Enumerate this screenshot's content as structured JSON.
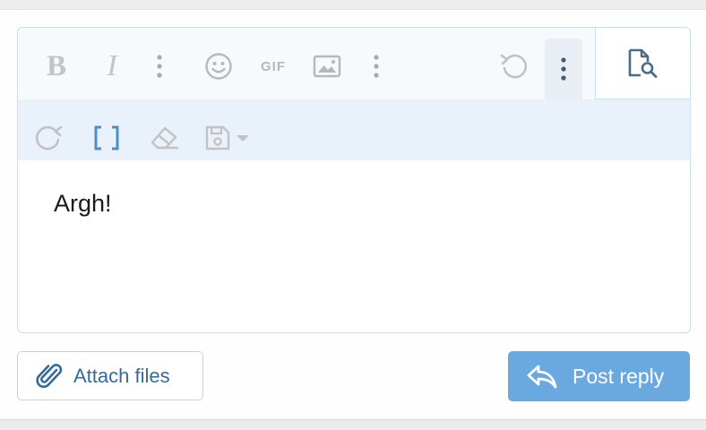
{
  "editor": {
    "content": "Argh!",
    "toolbar_row1": [
      {
        "name": "bold",
        "icon": "bold-icon",
        "glyph": "B"
      },
      {
        "name": "italic",
        "icon": "italic-icon",
        "glyph": "I"
      },
      {
        "name": "more-text-options",
        "icon": "vertical-ellipsis-icon"
      },
      {
        "name": "emoji",
        "icon": "smiley-icon"
      },
      {
        "name": "gif",
        "icon": "gif-icon",
        "glyph": "GIF"
      },
      {
        "name": "insert-image",
        "icon": "image-icon"
      },
      {
        "name": "more-insert-options",
        "icon": "vertical-ellipsis-icon"
      },
      {
        "name": "undo",
        "icon": "undo-icon"
      },
      {
        "name": "more-options",
        "icon": "vertical-ellipsis-icon",
        "active": true
      }
    ],
    "toolbar_row2": [
      {
        "name": "redo",
        "icon": "redo-icon"
      },
      {
        "name": "toggle-bbcode",
        "icon": "brackets-icon"
      },
      {
        "name": "remove-formatting",
        "icon": "eraser-icon"
      },
      {
        "name": "drafts",
        "icon": "save-icon",
        "has_dropdown": true
      }
    ],
    "preview": {
      "icon": "preview-document-search-icon"
    }
  },
  "actions": {
    "attach_label": "Attach files",
    "post_label": "Post reply"
  },
  "colors": {
    "accent": "#6aa9e0",
    "link": "#356b9b",
    "icon_muted": "#c4c4c4",
    "icon_active": "#4a6a86",
    "toolbar_bg": "#f6fafd",
    "toolbar_row2_bg": "#e9f2fa",
    "border": "#c9dfea"
  }
}
